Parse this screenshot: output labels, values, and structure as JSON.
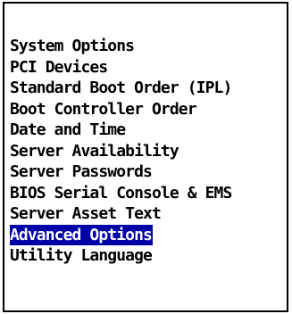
{
  "menu": {
    "items": [
      {
        "label": "System Options"
      },
      {
        "label": "PCI Devices"
      },
      {
        "label": "Standard Boot Order (IPL)"
      },
      {
        "label": "Boot Controller Order"
      },
      {
        "label": "Date and Time"
      },
      {
        "label": "Server Availability"
      },
      {
        "label": "Server Passwords"
      },
      {
        "label": "BIOS Serial Console & EMS"
      },
      {
        "label": "Server Asset Text"
      },
      {
        "label": "Advanced Options"
      },
      {
        "label": "Utility Language"
      }
    ],
    "selected_index": 9
  },
  "colors": {
    "background": "#ffffff",
    "text": "#000000",
    "border": "#000000",
    "highlight_background": "#0000a8",
    "highlight_text": "#ffffff"
  }
}
